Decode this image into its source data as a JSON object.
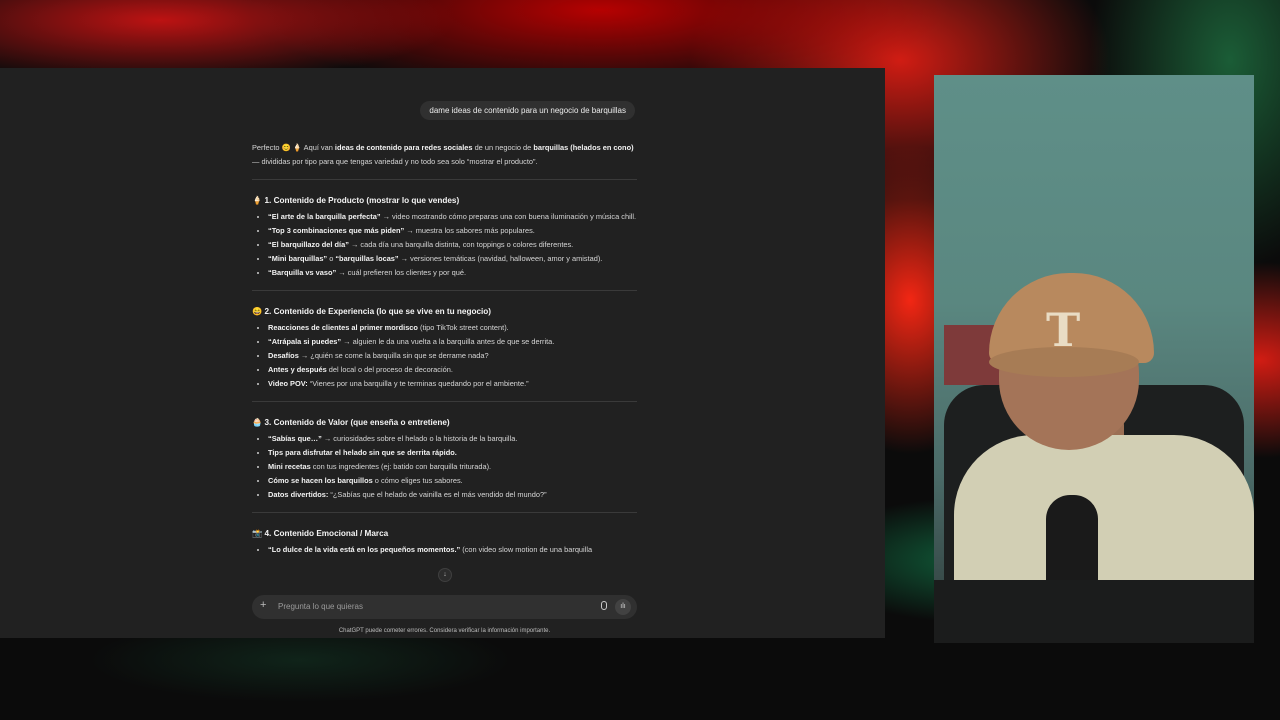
{
  "user_message": "dame ideas de contenido para un negocio de barquillas",
  "intro_parts": [
    {
      "t": "Perfecto 😊 🍦 Aquí van ",
      "b": false
    },
    {
      "t": "ideas de contenido para redes sociales",
      "b": true
    },
    {
      "t": " de un negocio de ",
      "b": false
    },
    {
      "t": "barquillas (helados en cono)",
      "b": true
    },
    {
      "t": " — divididas por tipo para que tengas variedad y no todo sea solo “mostrar el producto”.",
      "b": false
    }
  ],
  "sections": [
    {
      "emoji_color": "#f2b46b",
      "title": "🍦 1. Contenido de Producto (mostrar lo que vendes)",
      "items": [
        [
          {
            "t": "“El arte de la barquilla perfecta”",
            "b": true
          },
          {
            "t": " → video mostrando cómo preparas una con buena iluminación y música chill.",
            "b": false
          }
        ],
        [
          {
            "t": "“Top 3 combinaciones que más piden”",
            "b": true
          },
          {
            "t": " → muestra los sabores más populares.",
            "b": false
          }
        ],
        [
          {
            "t": "“El barquillazo del día”",
            "b": true
          },
          {
            "t": " → cada día una barquilla distinta, con toppings o colores diferentes.",
            "b": false
          }
        ],
        [
          {
            "t": "“Mini barquillas”",
            "b": true
          },
          {
            "t": " o ",
            "b": false
          },
          {
            "t": "“barquillas locas”",
            "b": true
          },
          {
            "t": " → versiones temáticas (navidad, halloween, amor y amistad).",
            "b": false
          }
        ],
        [
          {
            "t": "“Barquilla vs vaso”",
            "b": true
          },
          {
            "t": " → cuál prefieren los clientes y por qué.",
            "b": false
          }
        ]
      ]
    },
    {
      "emoji_color": "#f5b33c",
      "title": "😄 2. Contenido de Experiencia (lo que se vive en tu negocio)",
      "items": [
        [
          {
            "t": "Reacciones de clientes al primer mordisco",
            "b": true
          },
          {
            "t": " (tipo TikTok street content).",
            "b": false
          }
        ],
        [
          {
            "t": "“Atrápala si puedes”",
            "b": true
          },
          {
            "t": " → alguien le da una vuelta a la barquilla antes de que se derrita.",
            "b": false
          }
        ],
        [
          {
            "t": "Desafíos",
            "b": true
          },
          {
            "t": " → ¿quién se come la barquilla sin que se derrame nada?",
            "b": false
          }
        ],
        [
          {
            "t": "Antes y después",
            "b": true
          },
          {
            "t": " del local o del proceso de decoración.",
            "b": false
          }
        ],
        [
          {
            "t": "Video POV:",
            "b": true
          },
          {
            "t": " “Vienes por una barquilla y te terminas quedando por el ambiente.”",
            "b": false
          }
        ]
      ]
    },
    {
      "emoji_color": "#d88bd0",
      "title": "🧁 3. Contenido de Valor (que enseña o entretiene)",
      "items": [
        [
          {
            "t": "“Sabías que…”",
            "b": true
          },
          {
            "t": " → curiosidades sobre el helado o la historia de la barquilla.",
            "b": false
          }
        ],
        [
          {
            "t": "Tips para disfrutar el helado sin que se derrita rápido.",
            "b": true
          }
        ],
        [
          {
            "t": "Mini recetas",
            "b": true
          },
          {
            "t": " con tus ingredientes (ej: batido con barquilla triturada).",
            "b": false
          }
        ],
        [
          {
            "t": "Cómo se hacen los barquillos",
            "b": true
          },
          {
            "t": " o cómo eliges tus sabores.",
            "b": false
          }
        ],
        [
          {
            "t": "Datos divertidos:",
            "b": true
          },
          {
            "t": " “¿Sabías que el helado de vainilla es el más vendido del mundo?”",
            "b": false
          }
        ]
      ]
    },
    {
      "emoji_color": "#9bb7d6",
      "title": "📸 4. Contenido Emocional / Marca",
      "items": [
        [
          {
            "t": "“Lo dulce de la vida está en los pequeños momentos.”",
            "b": true
          },
          {
            "t": " (con video slow motion de una barquilla",
            "b": false
          }
        ]
      ]
    }
  ],
  "composer": {
    "placeholder": "Pregunta lo que quieras"
  },
  "disclaimer": "ChatGPT puede cometer errores. Considera verificar la información importante.",
  "icons": {
    "add": "plus-icon",
    "mic": "microphone-icon",
    "voice": "voice-mode-icon",
    "scroll": "arrow-down-icon"
  }
}
